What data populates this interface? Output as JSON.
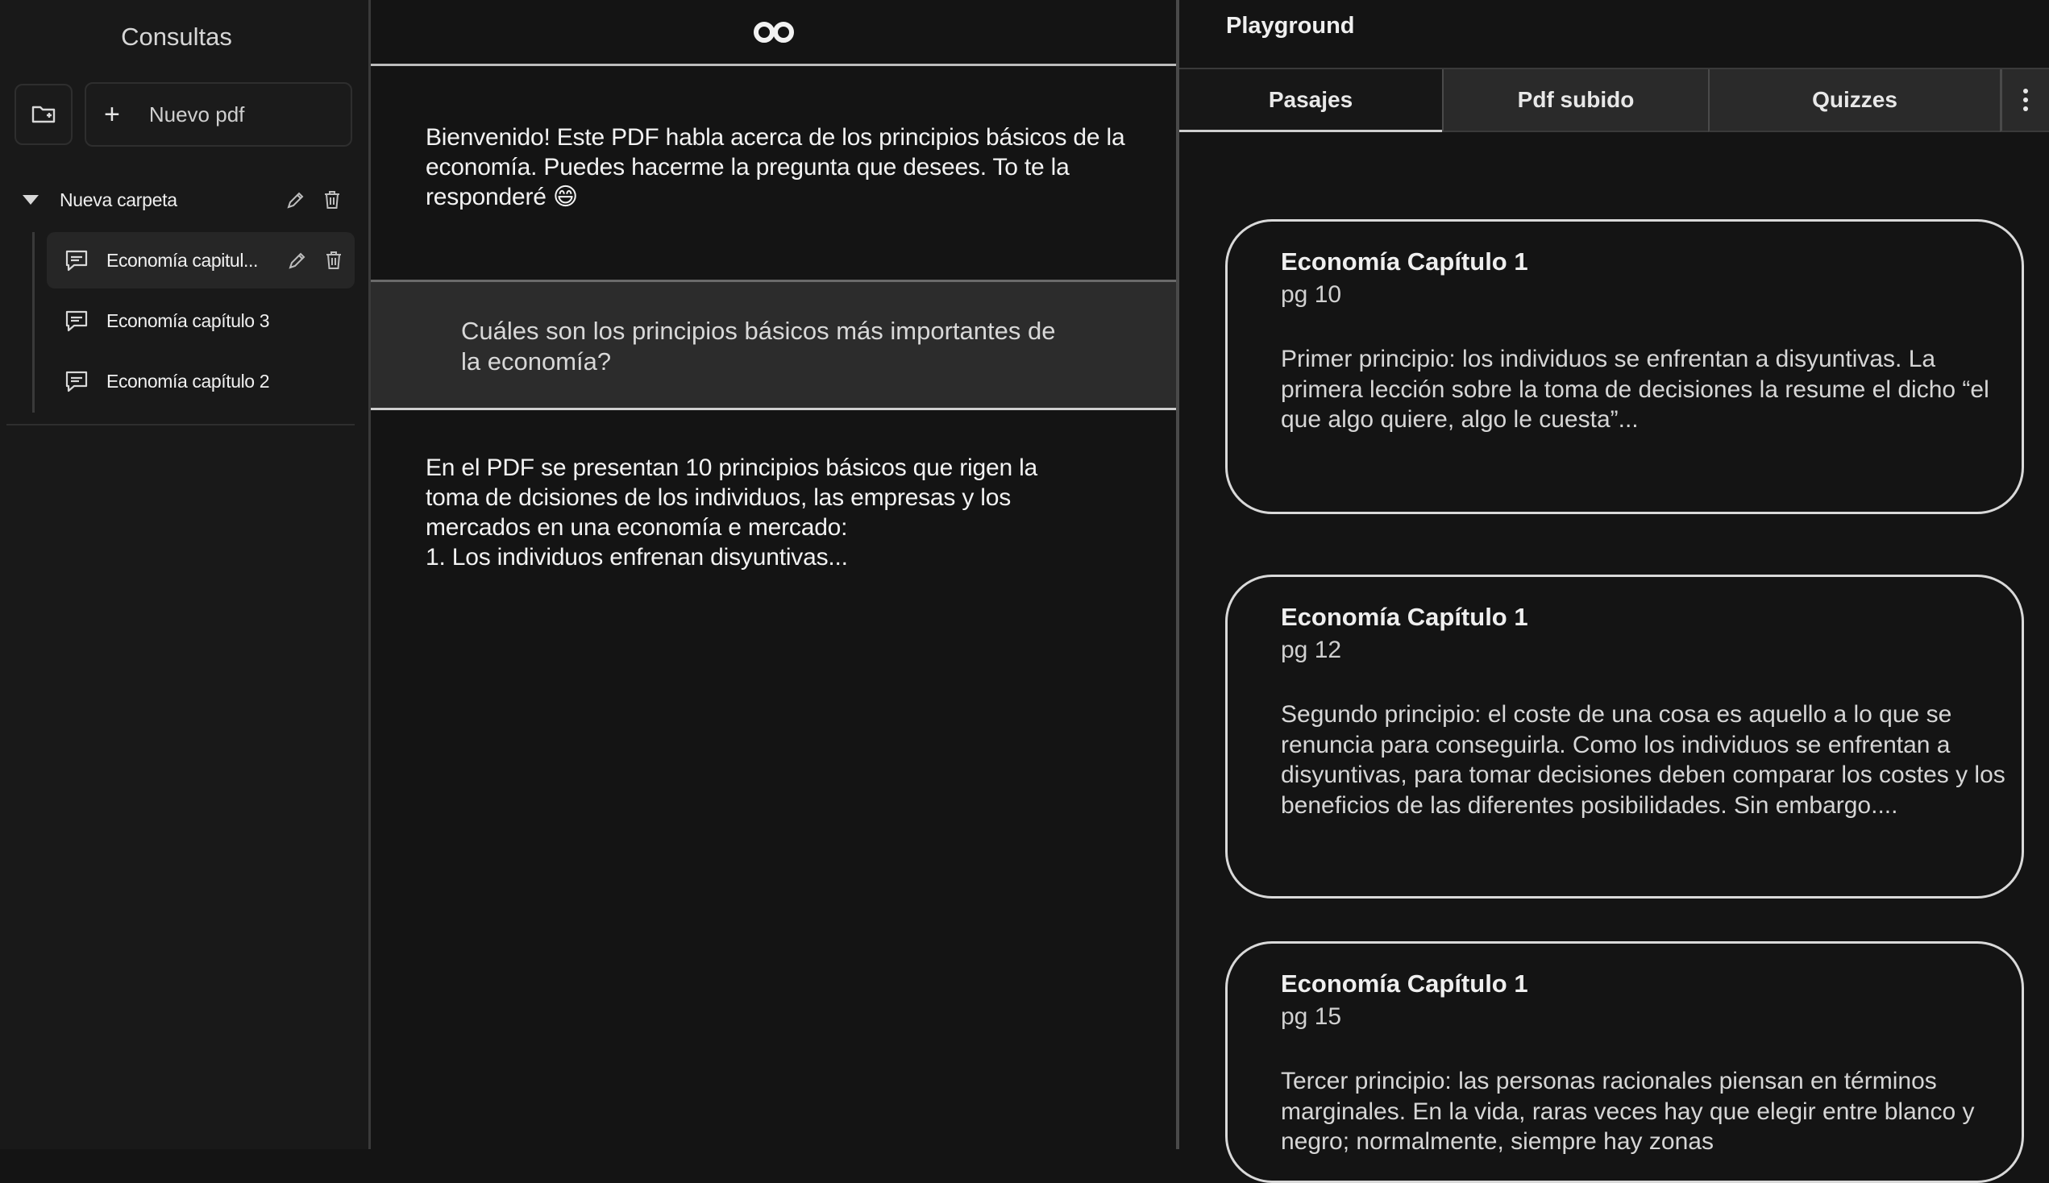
{
  "sidebar": {
    "title": "Consultas",
    "new_pdf_label": "Nuevo pdf",
    "folder": {
      "name": "Nueva carpeta"
    },
    "files": [
      {
        "label": "Economía capitul..."
      },
      {
        "label": "Economía capítulo 3"
      },
      {
        "label": "Economía capítulo 2"
      }
    ]
  },
  "chat": {
    "logo": "infinity-logo",
    "bot_welcome": "Bienvenido! Este PDF habla acerca de los principios básicos de la economía. Puedes hacerme la pregunta que desees. To te la responderé 😄",
    "user_question": "Cuáles son los principios básicos más importantes de la economía?",
    "bot_answer_lines": [
      "En el PDF se presentan 10 principios básicos que rigen la",
      "toma de dcisiones de los individuos, las empresas y los",
      "mercados en una economía e mercado:",
      "1. Los individuos enfrenan disyuntivas..."
    ]
  },
  "playground": {
    "title": "Playground",
    "tabs": [
      "Pasajes",
      "Pdf subido",
      "Quizzes"
    ],
    "active_tab": "Pasajes",
    "passages": [
      {
        "title": "Economía Capítulo 1",
        "page": "pg 10",
        "text": "Primer principio: los individuos se enfrentan a disyuntivas. La primera lección sobre la toma de decisiones la resume el dicho “el que algo quiere, algo le cuesta”..."
      },
      {
        "title": "Economía Capítulo 1",
        "page": "pg 12",
        "text": "Segundo principio: el coste de una cosa es aquello a lo que se renuncia para conseguirla. Como los individuos se enfrentan a disyuntivas, para tomar decisiones deben comparar los costes y los beneficios de las diferentes posibilidades. Sin embargo...."
      },
      {
        "title": "Economía Capítulo 1",
        "page": "pg 15",
        "text": "Tercer principio: las personas racionales piensan en términos marginales. En la vida, raras veces hay que elegir entre blanco y negro; normalmente, siempre hay zonas"
      }
    ]
  }
}
